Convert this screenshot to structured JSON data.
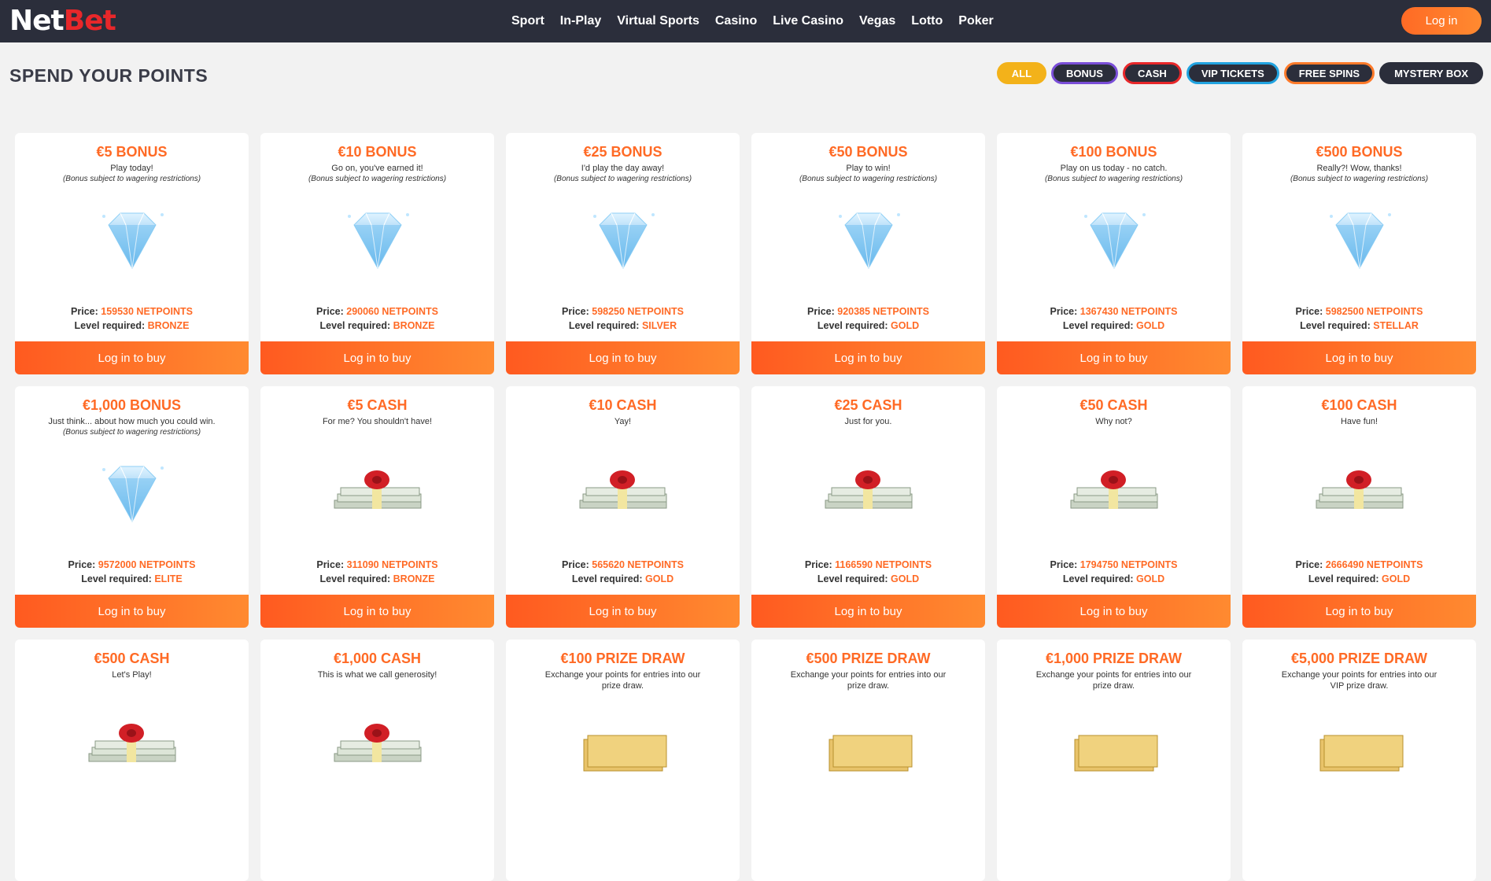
{
  "header": {
    "logo_net": "Net",
    "logo_bet": "Bet",
    "nav": [
      "Sport",
      "In-Play",
      "Virtual Sports",
      "Casino",
      "Live Casino",
      "Vegas",
      "Lotto",
      "Poker"
    ],
    "login_label": "Log in"
  },
  "page_title": "SPEND YOUR POINTS",
  "filters": [
    {
      "label": "ALL",
      "color": "#f3b21a"
    },
    {
      "label": "BONUS",
      "color": "#7a4ed8"
    },
    {
      "label": "CASH",
      "color": "#e8272a"
    },
    {
      "label": "VIP TICKETS",
      "color": "#21a3e0"
    },
    {
      "label": "FREE SPINS",
      "color": "#ff7a2a"
    },
    {
      "label": "MYSTERY BOX",
      "color": "#2b2e3b"
    }
  ],
  "labels": {
    "price": "Price:",
    "level": "Level required:",
    "buy": "Log in to buy"
  },
  "cards": [
    {
      "title": "€5 BONUS",
      "subtitle": "Play today!",
      "note": "(Bonus subject to wagering restrictions)",
      "icon": "diamond-icon",
      "price": "159530 NETPOINTS",
      "level": "BRONZE"
    },
    {
      "title": "€10 BONUS",
      "subtitle": "Go on, you've earned it!",
      "note": "(Bonus subject to wagering restrictions)",
      "icon": "diamond-icon",
      "price": "290060 NETPOINTS",
      "level": "BRONZE"
    },
    {
      "title": "€25 BONUS",
      "subtitle": "I'd play the day away!",
      "note": "(Bonus subject to wagering restrictions)",
      "icon": "diamond-icon",
      "price": "598250 NETPOINTS",
      "level": "SILVER"
    },
    {
      "title": "€50 BONUS",
      "subtitle": "Play to win!",
      "note": "(Bonus subject to wagering restrictions)",
      "icon": "diamond-icon",
      "price": "920385 NETPOINTS",
      "level": "GOLD"
    },
    {
      "title": "€100 BONUS",
      "subtitle": "Play on us today - no catch.",
      "note": "(Bonus subject to wagering restrictions)",
      "icon": "diamond-icon",
      "price": "1367430 NETPOINTS",
      "level": "GOLD"
    },
    {
      "title": "€500 BONUS",
      "subtitle": "Really?! Wow, thanks!",
      "note": "(Bonus subject to wagering restrictions)",
      "icon": "diamond-icon",
      "price": "5982500 NETPOINTS",
      "level": "STELLAR"
    },
    {
      "title": "€1,000 BONUS",
      "subtitle": "Just think... about how much you could win.",
      "note": "(Bonus subject to wagering restrictions)",
      "icon": "diamond-icon",
      "price": "9572000 NETPOINTS",
      "level": "ELITE"
    },
    {
      "title": "€5 CASH",
      "subtitle": "For me? You shouldn't have!",
      "note": "",
      "icon": "cash-gift-icon",
      "price": "311090 NETPOINTS",
      "level": "BRONZE"
    },
    {
      "title": "€10 CASH",
      "subtitle": "Yay!",
      "note": "",
      "icon": "cash-gift-icon",
      "price": "565620 NETPOINTS",
      "level": "GOLD"
    },
    {
      "title": "€25 CASH",
      "subtitle": "Just for you.",
      "note": "",
      "icon": "cash-gift-icon",
      "price": "1166590 NETPOINTS",
      "level": "GOLD"
    },
    {
      "title": "€50 CASH",
      "subtitle": "Why not?",
      "note": "",
      "icon": "cash-gift-icon",
      "price": "1794750 NETPOINTS",
      "level": "GOLD"
    },
    {
      "title": "€100 CASH",
      "subtitle": "Have fun!",
      "note": "",
      "icon": "cash-gift-icon",
      "price": "2666490 NETPOINTS",
      "level": "GOLD"
    },
    {
      "title": "€500 CASH",
      "subtitle": "Let's Play!",
      "note": "",
      "icon": "cash-gift-icon",
      "price": "",
      "level": ""
    },
    {
      "title": "€1,000 CASH",
      "subtitle": "This is what we call generosity!",
      "note": "",
      "icon": "cash-gift-icon",
      "price": "",
      "level": ""
    },
    {
      "title": "€100 PRIZE DRAW",
      "subtitle": "Exchange your points for entries into our prize draw.",
      "note": "",
      "icon": "ticket-icon",
      "price": "",
      "level": ""
    },
    {
      "title": "€500 PRIZE DRAW",
      "subtitle": "Exchange your points for entries into our prize draw.",
      "note": "",
      "icon": "ticket-icon",
      "price": "",
      "level": ""
    },
    {
      "title": "€1,000 PRIZE DRAW",
      "subtitle": "Exchange your points for entries into our prize draw.",
      "note": "",
      "icon": "ticket-icon",
      "price": "",
      "level": ""
    },
    {
      "title": "€5,000 PRIZE DRAW",
      "subtitle": "Exchange your points for entries into our VIP prize draw.",
      "note": "",
      "icon": "ticket-icon",
      "price": "",
      "level": ""
    }
  ]
}
